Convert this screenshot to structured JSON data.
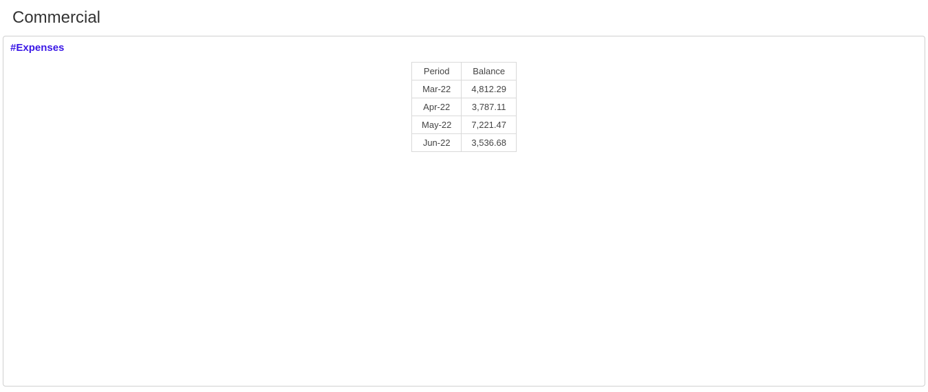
{
  "header": {
    "title": "Commercial"
  },
  "panel": {
    "title": "#Expenses"
  },
  "table": {
    "headers": {
      "period": "Period",
      "balance": "Balance"
    },
    "rows": [
      {
        "period": "Mar-22",
        "balance": "4,812.29"
      },
      {
        "period": "Apr-22",
        "balance": "3,787.11"
      },
      {
        "period": "May-22",
        "balance": "7,221.47"
      },
      {
        "period": "Jun-22",
        "balance": "3,536.68"
      }
    ]
  }
}
